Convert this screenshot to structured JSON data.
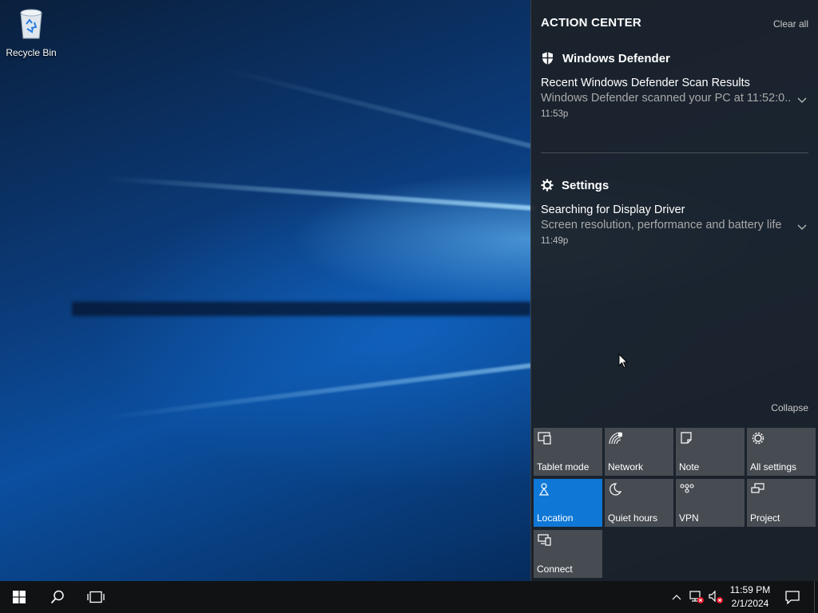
{
  "desktop": {
    "icons": [
      {
        "label": "Recycle Bin",
        "icon": "recycle-bin-icon"
      }
    ]
  },
  "action_center": {
    "title": "ACTION CENTER",
    "clear_all": "Clear all",
    "collapse": "Collapse",
    "groups": [
      {
        "app": "Windows Defender",
        "icon": "shield-icon",
        "notifications": [
          {
            "title": "Recent Windows Defender Scan Results",
            "body": "Windows Defender scanned your PC at 11:52:0...",
            "time": "11:53p"
          }
        ]
      },
      {
        "app": "Settings",
        "icon": "gear-icon",
        "notifications": [
          {
            "title": "Searching for Display Driver",
            "body": "Screen resolution, performance and battery life",
            "time": "11:49p"
          }
        ]
      }
    ],
    "quick_actions": [
      {
        "label": "Tablet mode",
        "icon": "tablet-mode-icon",
        "active": false
      },
      {
        "label": "Network",
        "icon": "network-icon",
        "active": false
      },
      {
        "label": "Note",
        "icon": "note-icon",
        "active": false
      },
      {
        "label": "All settings",
        "icon": "gear-icon",
        "active": false
      },
      {
        "label": "Location",
        "icon": "location-icon",
        "active": true
      },
      {
        "label": "Quiet hours",
        "icon": "moon-icon",
        "active": false
      },
      {
        "label": "VPN",
        "icon": "vpn-icon",
        "active": false
      },
      {
        "label": "Project",
        "icon": "project-icon",
        "active": false
      },
      {
        "label": "Connect",
        "icon": "connect-icon",
        "active": false
      }
    ]
  },
  "taskbar": {
    "clock": {
      "time": "11:59 PM",
      "date": "2/1/2024"
    },
    "start_icon": "windows-logo-icon",
    "search_icon": "search-icon",
    "task_view_icon": "task-view-icon",
    "tray_icons": [
      "chevron-up-icon",
      "network-disconnected-icon",
      "speaker-muted-icon",
      "action-center-icon"
    ]
  },
  "colors": {
    "accent": "#0f78d6",
    "tile": "#474c53",
    "panel": "#1c2128",
    "taskbar": "#101214"
  }
}
